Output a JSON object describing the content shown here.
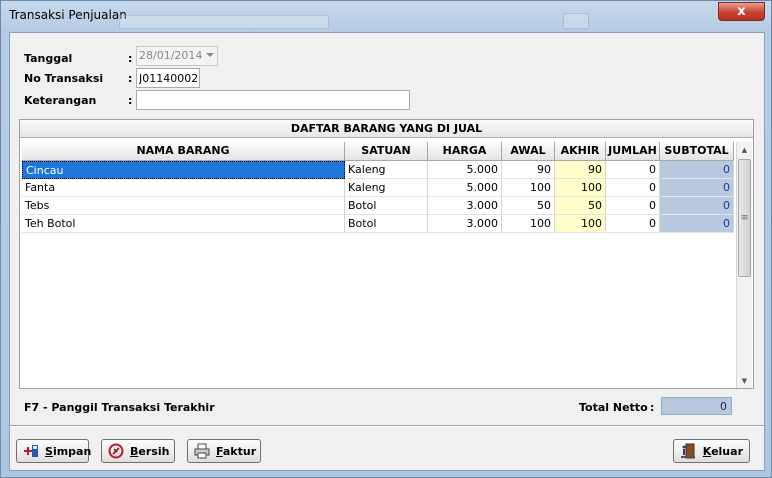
{
  "window": {
    "title": "Transaksi Penjualan",
    "close_glyph": "x"
  },
  "form": {
    "tanggal_label": "Tanggal",
    "tanggal_value": "28/01/2014",
    "no_transaksi_label": "No Transaksi",
    "no_transaksi_value": "J01140002",
    "keterangan_label": "Keterangan",
    "keterangan_value": "",
    "colon": ":"
  },
  "grid": {
    "title": "DAFTAR BARANG YANG DI JUAL",
    "headers": [
      "NAMA BARANG",
      "SATUAN",
      "HARGA",
      "AWAL",
      "AKHIR",
      "JUMLAH",
      "SUBTOTAL"
    ],
    "rows": [
      [
        "Cincau",
        "Kaleng",
        "5.000",
        "90",
        "90",
        "0",
        "0"
      ],
      [
        "Fanta",
        "Kaleng",
        "5.000",
        "100",
        "100",
        "0",
        "0"
      ],
      [
        "Tebs",
        "Botol",
        "3.000",
        "50",
        "50",
        "0",
        "0"
      ],
      [
        "Teh Botol",
        "Botol",
        "3.000",
        "100",
        "100",
        "0",
        "0"
      ]
    ],
    "selected_row": 0
  },
  "footer": {
    "hint": "F7 - Panggil Transaksi Terakhir",
    "total_label": "Total Netto",
    "total_colon": ":",
    "total_value": "0"
  },
  "buttons": {
    "simpan": "Simpan",
    "bersih": "Bersih",
    "faktur": "Faktur",
    "keluar": "Keluar"
  },
  "icons": {
    "simpan": "save-plus-icon",
    "bersih": "clear-icon",
    "faktur": "printer-icon",
    "keluar": "exit-door-icon"
  },
  "colors": {
    "akhir_bg": "#ffffcc",
    "subtotal_bg": "#b8c8de",
    "selected_bg": "#1e74d8",
    "close_bg": "#c7432f"
  }
}
